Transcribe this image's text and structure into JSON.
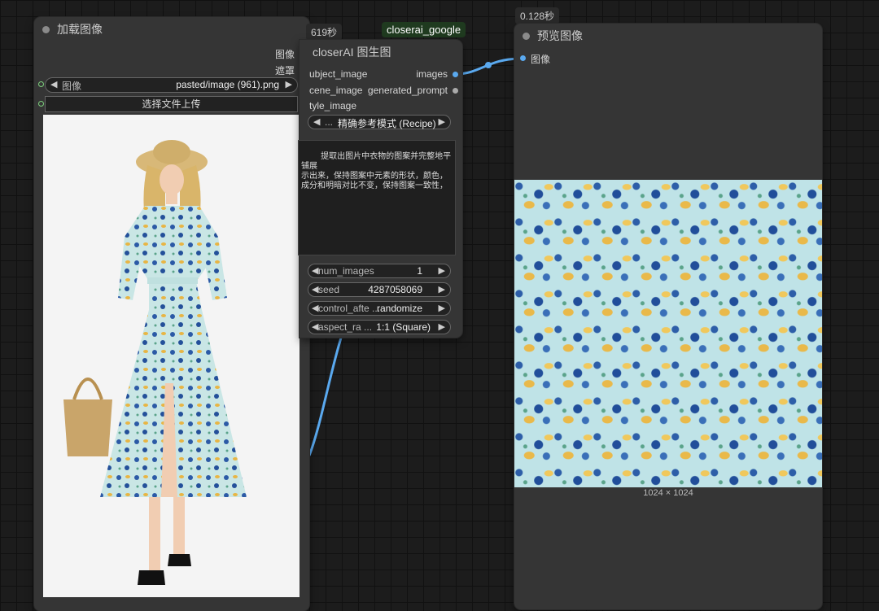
{
  "load_node": {
    "title": "加载图像",
    "outputs": [
      "图像",
      "遮罩"
    ],
    "image_widget": {
      "name": "图像",
      "value": "pasted/image (961).png"
    },
    "upload_button": "选择文件上传"
  },
  "recipe_node": {
    "timing": "619秒",
    "title": "closerAI 图生图",
    "provider_badge": "closerai_google",
    "inputs": [
      "ubject_image",
      "cene_image",
      "tyle_image"
    ],
    "outputs": [
      "images",
      "generated_prompt"
    ],
    "mode_widget": {
      "name": "...",
      "value": "精确参考模式 (Recipe)"
    },
    "prompt_text": "提取出图片中衣物的图案并完整地平铺展\n示出来，保持图案中元素的形状，颜色，\n成分和明暗对比不变，保持图案一致性，",
    "widgets": [
      {
        "name": "num_images",
        "value": "1"
      },
      {
        "name": "seed",
        "value": "4287058069"
      },
      {
        "name": "control_afte ...",
        "value": "randomize"
      },
      {
        "name": "aspect_ra ...",
        "value": "1:1 (Square)"
      }
    ]
  },
  "preview_node": {
    "timing": "0.128秒",
    "title": "预览图像",
    "input": "图像",
    "image_size": "1024 × 1024"
  },
  "colors": {
    "link_blue": "#5aa9ef",
    "slot_green": "#7ccf7c",
    "badge_bg": "#1f3a1f"
  }
}
